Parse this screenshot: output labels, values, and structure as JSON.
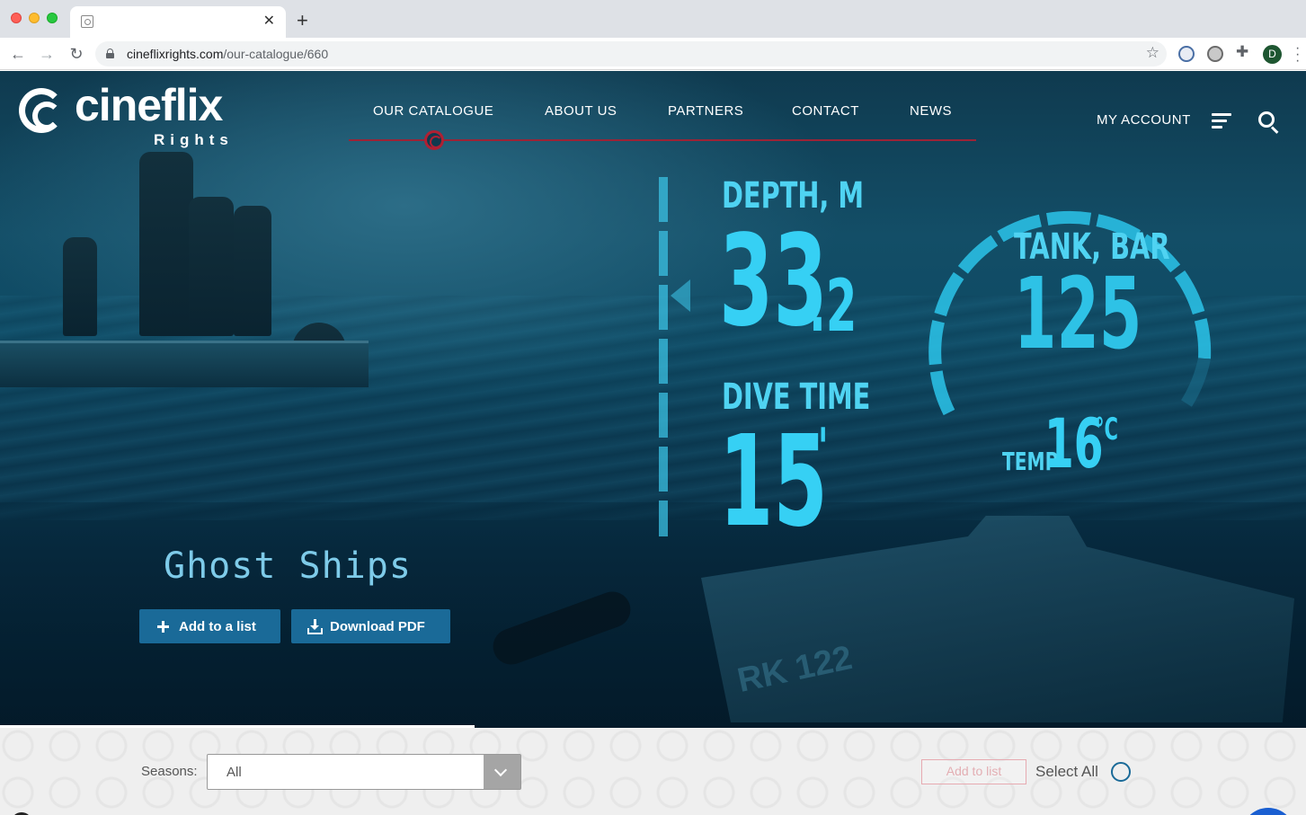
{
  "browser": {
    "url_host": "cineflixrights.com",
    "url_path": "/our-catalogue/660",
    "avatar_initial": "D",
    "icons": [
      "back-icon",
      "forward-icon",
      "reload-icon",
      "lock-icon",
      "star-icon",
      "puzzle-icon",
      "close-icon",
      "plus-icon"
    ]
  },
  "site": {
    "logo_word": "cineflix",
    "logo_sub": "Rights",
    "nav": [
      "OUR CATALOGUE",
      "ABOUT US",
      "PARTNERS",
      "CONTACT",
      "NEWS"
    ],
    "account": "MY ACCOUNT",
    "accent_color": "#9c2336",
    "button_color": "#1a6a98"
  },
  "hero": {
    "depth_label": "DEPTH, M",
    "depth_value": "33",
    "depth_decimal": ".2",
    "dive_label": "DIVE TIME",
    "dive_value": "15",
    "dive_unit": "'",
    "tank_label": "TANK, BAR",
    "tank_value": "125",
    "temp_label": "TEMP",
    "temp_value": "16",
    "temp_unit": "°C",
    "wreck_marking": "RK 122",
    "title": "Ghost Ships",
    "add_button": "Add to a list",
    "pdf_button": "Download PDF"
  },
  "filters": {
    "seasons_label": "Seasons:",
    "seasons_value": "All",
    "add_to_list": "Add to list",
    "select_all": "Select All"
  }
}
